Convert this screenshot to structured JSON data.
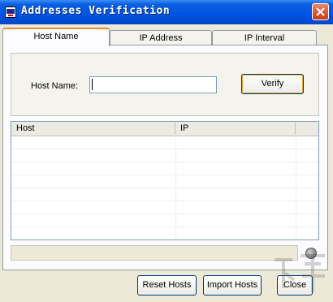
{
  "window": {
    "title": "Addresses Verification"
  },
  "tabs": [
    {
      "label": "Host Name",
      "active": true
    },
    {
      "label": "IP Address",
      "active": false
    },
    {
      "label": "IP Interval",
      "active": false
    }
  ],
  "form": {
    "host_label": "Host Name:",
    "host_value": "",
    "verify_label": "Verify"
  },
  "table": {
    "columns": [
      "Host",
      "IP",
      ""
    ],
    "rows": []
  },
  "footer": {
    "reset_label": "Reset Hosts",
    "import_label": "Import Hosts",
    "close_label": "Close"
  },
  "colors": {
    "titlebar": "#0055E5",
    "active_tab_accent": "#E68B2C",
    "dialog_bg": "#ECE9D8"
  }
}
